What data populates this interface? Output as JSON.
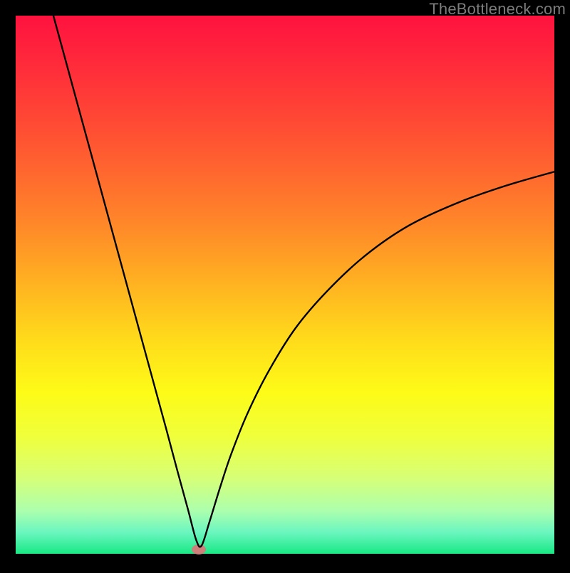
{
  "attribution": "TheBottleneck.com",
  "chart_data": {
    "type": "line",
    "title": "",
    "xlabel": "",
    "ylabel": "",
    "xlim": [
      0,
      100
    ],
    "ylim": [
      0,
      100
    ],
    "notes": "V-shaped bottleneck curve. Vertex (minimum) near x≈34, y≈0. Left branch nearly linear/steep from (~7,100) down to vertex. Right branch rises with diminishing slope toward (~100,~71). Background is a vertical rainbow gradient red→green; plot area has black border ~22px all around.",
    "gradient_stops": [
      {
        "offset": 0.0,
        "color": "#ff123f"
      },
      {
        "offset": 0.1,
        "color": "#ff2d3a"
      },
      {
        "offset": 0.2,
        "color": "#ff4a34"
      },
      {
        "offset": 0.3,
        "color": "#ff6a2e"
      },
      {
        "offset": 0.4,
        "color": "#ff8c28"
      },
      {
        "offset": 0.5,
        "color": "#ffb321"
      },
      {
        "offset": 0.6,
        "color": "#ffda1b"
      },
      {
        "offset": 0.7,
        "color": "#fdfb17"
      },
      {
        "offset": 0.78,
        "color": "#f0ff3a"
      },
      {
        "offset": 0.86,
        "color": "#d6ff78"
      },
      {
        "offset": 0.92,
        "color": "#acffad"
      },
      {
        "offset": 0.96,
        "color": "#6bf6c0"
      },
      {
        "offset": 1.0,
        "color": "#18e884"
      }
    ],
    "series": [
      {
        "name": "bottleneck-curve",
        "x": [
          7.0,
          10,
          13,
          16,
          19,
          22,
          25,
          28,
          30,
          32,
          33.5,
          34.5,
          36,
          38,
          40,
          43,
          47,
          52,
          58,
          65,
          73,
          82,
          91,
          100
        ],
        "y": [
          100,
          89,
          78,
          67,
          56,
          45,
          34,
          23,
          15.5,
          8.2,
          2.6,
          1.5,
          6.0,
          12.5,
          18.5,
          26.0,
          34.0,
          42.0,
          49.0,
          55.5,
          61.0,
          65.2,
          68.4,
          71.0
        ]
      }
    ],
    "marker": {
      "x": 34.0,
      "y": 0.8,
      "color": "#cd7f7a",
      "rx": 10,
      "ry": 7
    }
  }
}
